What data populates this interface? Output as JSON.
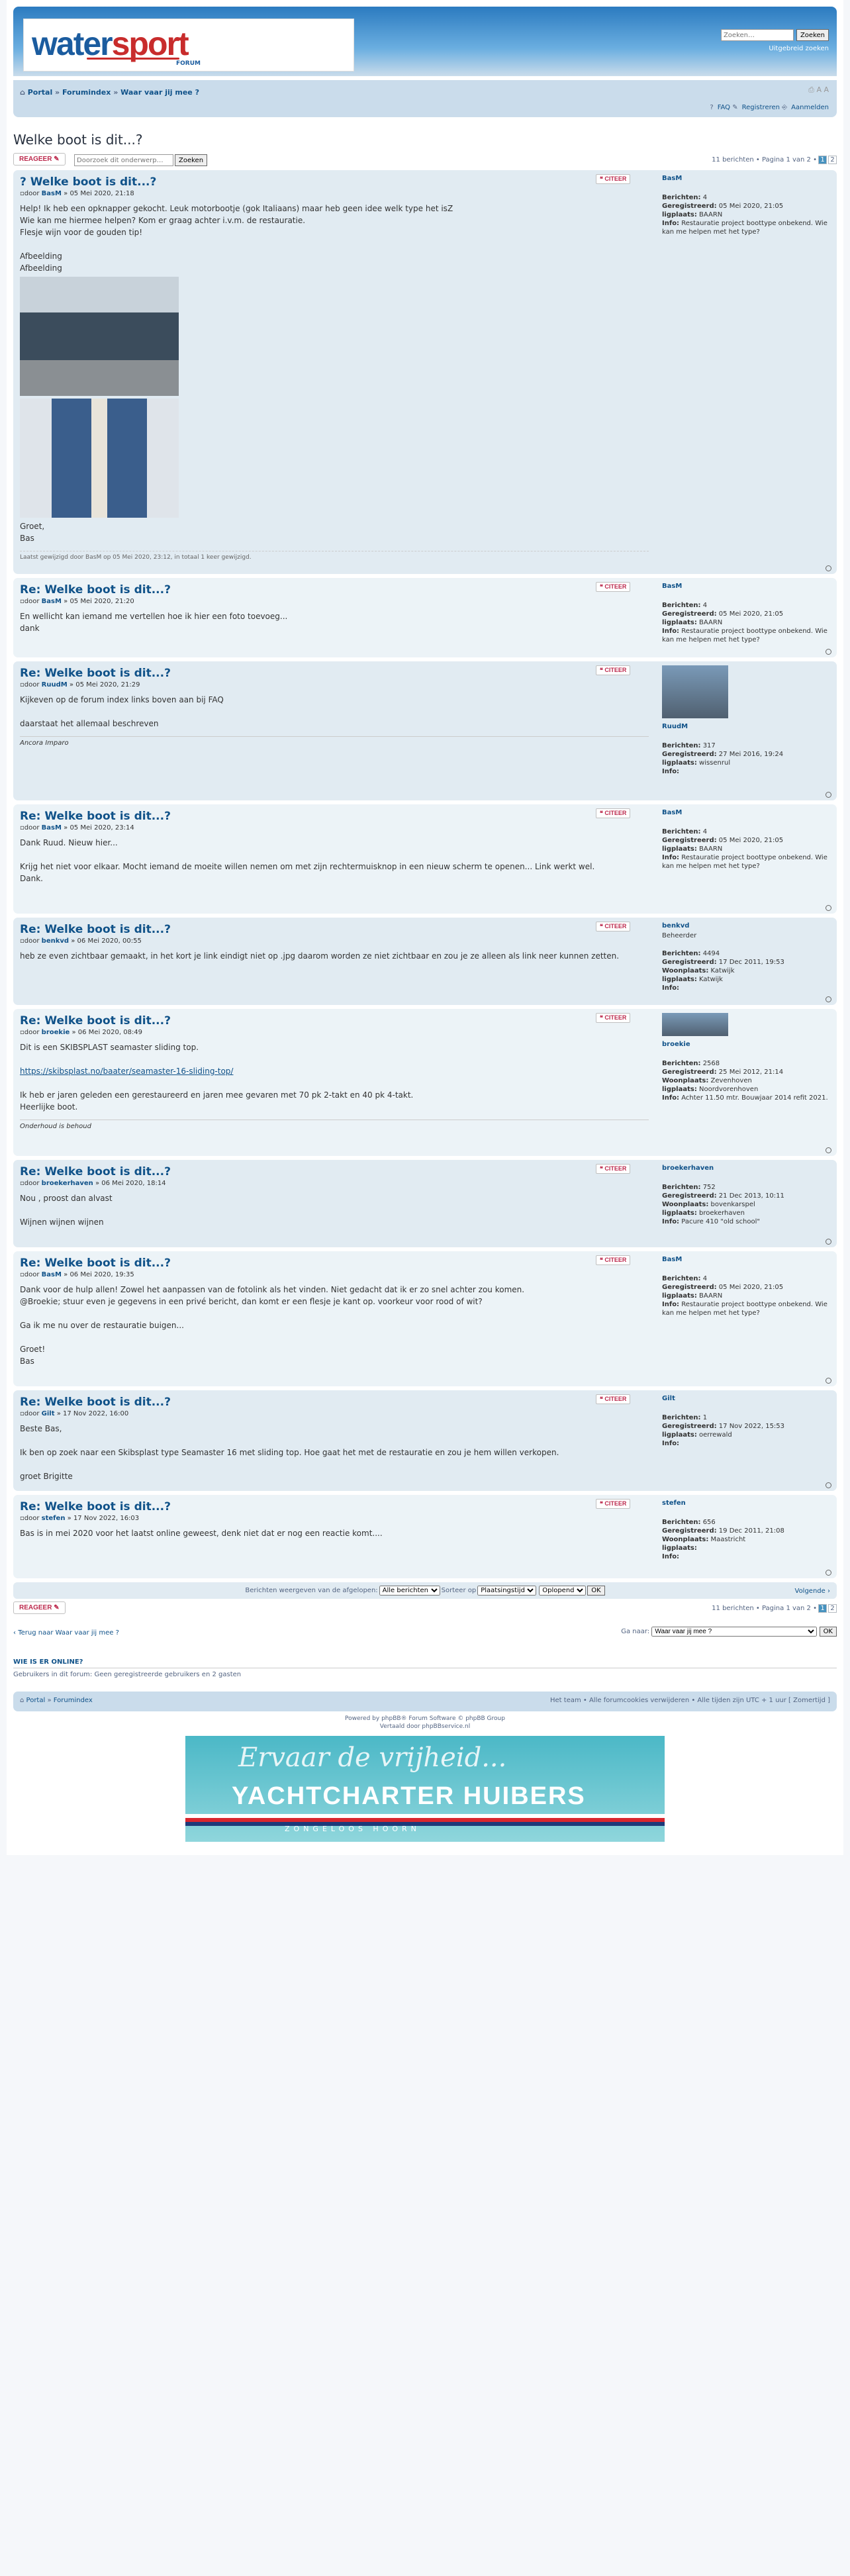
{
  "header": {
    "logo_text_a": "water",
    "logo_text_b": "sport",
    "logo_sub": "FORUM",
    "search_placeholder": "Zoeken…",
    "search_btn": "Zoeken",
    "advanced": "Uitgebreid zoeken"
  },
  "nav": {
    "portal": "Portal",
    "forum": "Forumindex",
    "section": "Waar vaar jij mee ?",
    "faq": "FAQ",
    "register": "Registreren",
    "login": "Aanmelden"
  },
  "topic": {
    "title": "Welke boot is dit...?",
    "reply": "REAGEER",
    "search_placeholder": "Doorzoek dit onderwerp…",
    "search_btn": "Zoeken",
    "pagination": "11 berichten • Pagina 1 van 2 •",
    "page1": "1",
    "page2": "2"
  },
  "labels": {
    "quote": "CITEER",
    "by": "door",
    "posts": "Berichten:",
    "registered": "Geregistreerd:",
    "location": "ligplaats:",
    "residence": "Woonplaats:",
    "info": "Info:"
  },
  "posts": [
    {
      "subject": "Welke boot is dit...?",
      "author": "BasM",
      "date": "05 Mei 2020, 21:18",
      "lines": [
        "Help! Ik heb een opknapper gekocht. Leuk motorbootje (gok Italiaans) maar heb geen idee welk type het isZ",
        "Wie kan me hiermee helpen? Kom er graag achter i.v.m. de restauratie.",
        "Flesje wijn voor de gouden tip!"
      ],
      "img1": "Afbeelding",
      "img2": "Afbeelding",
      "closing": [
        "Groet,",
        "Bas"
      ],
      "notice": "Laatst gewijzigd door BasM op 05 Mei 2020, 23:12, in totaal 1 keer gewijzigd.",
      "p_name": "BasM",
      "p_posts": "4",
      "p_reg": "05 Mei 2020, 21:05",
      "p_loc": "BAARN",
      "p_info": "Restauratie project boottype onbekend. Wie kan me helpen met het type?"
    },
    {
      "subject": "Re: Welke boot is dit...?",
      "author": "BasM",
      "date": "05 Mei 2020, 21:20",
      "lines": [
        "En wellicht kan iemand me vertellen hoe ik hier een foto toevoeg...",
        "dank"
      ],
      "p_name": "BasM",
      "p_posts": "4",
      "p_reg": "05 Mei 2020, 21:05",
      "p_loc": "BAARN",
      "p_info": "Restauratie project boottype onbekend. Wie kan me helpen met het type?"
    },
    {
      "subject": "Re: Welke boot is dit...?",
      "author": "RuudM",
      "date": "05 Mei 2020, 21:29",
      "lines": [
        "Kijkeven op de forum index links boven aan bij FAQ",
        "",
        "daarstaat het allemaal beschreven"
      ],
      "sig": "Ancora Imparo",
      "p_name": "RuudM",
      "p_posts": "317",
      "p_reg": "27 Mei 2016, 19:24",
      "p_loc": "wissenrul",
      "p_info": ""
    },
    {
      "subject": "Re: Welke boot is dit...?",
      "author": "BasM",
      "date": "05 Mei 2020, 23:14",
      "lines": [
        "Dank Ruud. Nieuw hier...",
        "",
        "Krijg het niet voor elkaar. Mocht iemand de moeite willen nemen om met zijn rechtermuisknop in een nieuw scherm te openen... Link werkt wel.",
        "Dank."
      ],
      "p_name": "BasM",
      "p_posts": "4",
      "p_reg": "05 Mei 2020, 21:05",
      "p_loc": "BAARN",
      "p_info": "Restauratie project boottype onbekend. Wie kan me helpen met het type?"
    },
    {
      "subject": "Re: Welke boot is dit...?",
      "author": "benkvd",
      "date": "06 Mei 2020, 00:55",
      "lines": [
        "heb ze even zichtbaar gemaakt, in het kort je link eindigt niet op .jpg daarom worden ze niet zichtbaar en zou je ze alleen als link neer kunnen zetten."
      ],
      "p_name": "benkvd",
      "p_role": "Beheerder",
      "p_posts": "4494",
      "p_reg": "17 Dec 2011, 19:53",
      "p_res": "Katwijk",
      "p_loc": "Katwijk",
      "p_info": ""
    },
    {
      "subject": "Re: Welke boot is dit...?",
      "author": "broekie",
      "date": "06 Mei 2020, 08:49",
      "lines": [
        "Dit is een SKIBSPLAST seamaster sliding top."
      ],
      "link": "https://skibsplast.no/baater/seamaster-16-sliding-top/",
      "lines2": [
        "Ik heb er jaren geleden een gerestaureerd en jaren mee gevaren met 70 pk 2-takt en 40 pk 4-takt.",
        "Heerlijke boot."
      ],
      "sig": "Onderhoud is behoud",
      "p_name": "broekie",
      "p_posts": "2568",
      "p_reg": "25 Mei 2012, 21:14",
      "p_res": "Zevenhoven",
      "p_loc": "Noordvorenhoven",
      "p_info": "Achter 11.50 mtr. Bouwjaar 2014 refit 2021."
    },
    {
      "subject": "Re: Welke boot is dit...?",
      "author": "broekerhaven",
      "date": "06 Mei 2020, 18:14",
      "lines": [
        "Nou , proost dan alvast",
        "",
        "Wijnen wijnen wijnen"
      ],
      "p_name": "broekerhaven",
      "p_posts": "752",
      "p_reg": "21 Dec 2013, 10:11",
      "p_res": "bovenkarspel",
      "p_loc": "broekerhaven",
      "p_info": "Pacure 410 \"old school\""
    },
    {
      "subject": "Re: Welke boot is dit...?",
      "author": "BasM",
      "date": "06 Mei 2020, 19:35",
      "lines": [
        "Dank voor de hulp allen! Zowel het aanpassen van de fotolink als het vinden. Niet gedacht dat ik er zo snel achter zou komen.",
        "@Broekie; stuur even je gegevens in een privé bericht, dan komt er een flesje je kant op. voorkeur voor rood of wit?",
        "",
        "Ga ik me nu over de restauratie buigen...",
        "",
        "Groet!",
        "Bas"
      ],
      "p_name": "BasM",
      "p_posts": "4",
      "p_reg": "05 Mei 2020, 21:05",
      "p_loc": "BAARN",
      "p_info": "Restauratie project boottype onbekend. Wie kan me helpen met het type?"
    },
    {
      "subject": "Re: Welke boot is dit...?",
      "author": "Gilt",
      "date": "17 Nov 2022, 16:00",
      "lines": [
        "Beste Bas,",
        "",
        "Ik ben op zoek naar een Skibsplast type Seamaster 16 met sliding top. Hoe gaat het met de restauratie en zou je hem willen verkopen.",
        "",
        "groet Brigitte"
      ],
      "p_name": "Gilt",
      "p_posts": "1",
      "p_reg": "17 Nov 2022, 15:53",
      "p_loc": "oerrewald",
      "p_info": ""
    },
    {
      "subject": "Re: Welke boot is dit...?",
      "author": "stefen",
      "date": "17 Nov 2022, 16:03",
      "lines": [
        "Bas is in mei 2020 voor het laatst online geweest, denk niet dat er nog een reactie komt...."
      ],
      "p_name": "stefen",
      "p_posts": "656",
      "p_reg": "19 Dec 2011, 21:08",
      "p_res": "Maastricht",
      "p_loc": "",
      "p_info": ""
    }
  ],
  "sort": {
    "show": "Berichten weergeven van de afgelopen:",
    "show_val": "Alle berichten",
    "sort": "Sorteer op",
    "sort_val": "Plaatsingstijd",
    "dir_val": "Oplopend",
    "go": "OK",
    "next": "Volgende"
  },
  "jump": {
    "back": "Terug naar Waar vaar jij mee ?",
    "label": "Ga naar:",
    "value": "Waar vaar jij mee ?",
    "go": "OK"
  },
  "online": {
    "title": "WIE IS ER ONLINE?",
    "text": "Gebruikers in dit forum: Geen geregistreerde gebruikers en 2 gasten"
  },
  "footer": {
    "portal": "Portal",
    "forum": "Forumindex",
    "right": "Het team • Alle forumcookies verwijderen • Alle tijden zijn UTC + 1 uur [ Zomertijd ]",
    "powered": "Powered by phpBB® Forum Software © phpBB Group",
    "translated": "Vertaald door phpBBservice.nl"
  },
  "banner": {
    "script": "Ervaar de vrijheid...",
    "name": "YACHTCHARTER HUIBERS",
    "place": "ZONGELOOS HOORN"
  }
}
